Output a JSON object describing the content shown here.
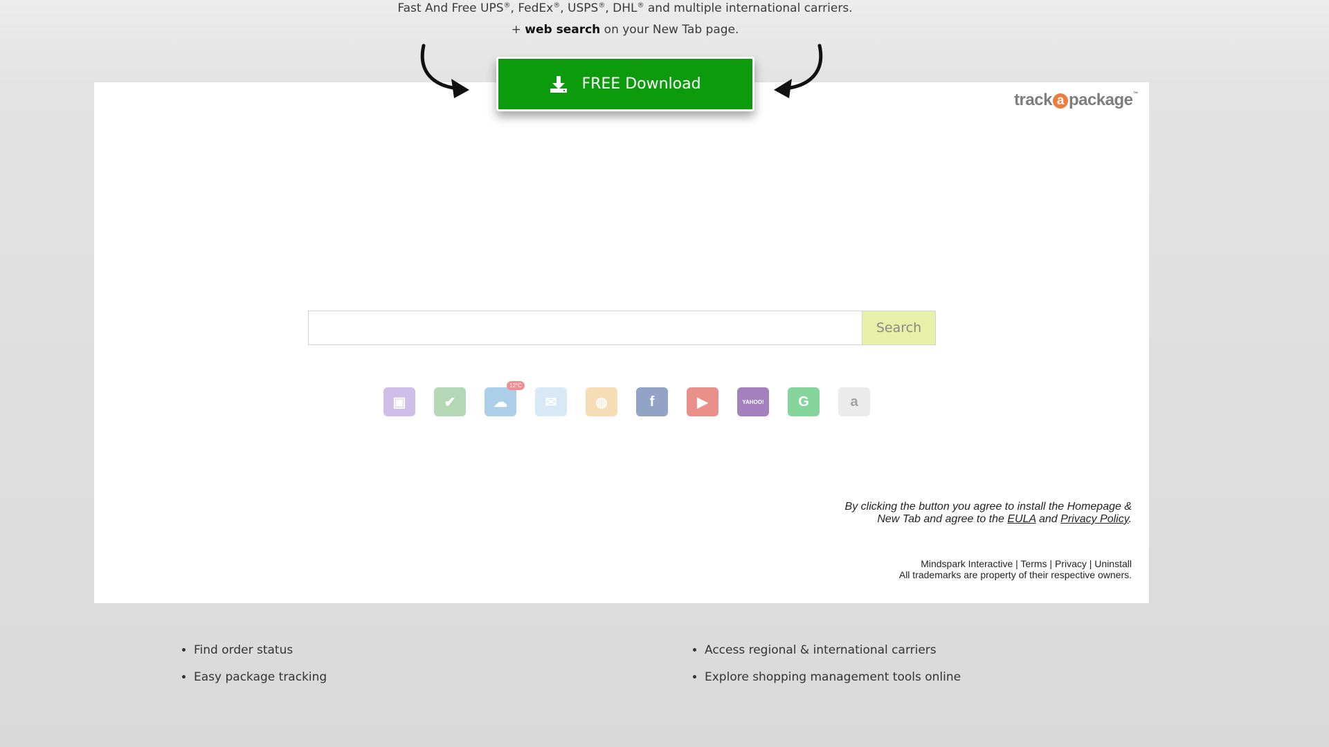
{
  "header": {
    "line1_a": "Fast And Free UPS",
    "line1_b": ", FedEx",
    "line1_c": ", USPS",
    "line1_d": ", DHL",
    "line1_e": " and multiple international carriers.",
    "reg": "®",
    "line2_prefix": "+ ",
    "line2_bold": "web search",
    "line2_suffix": " on your New Tab page."
  },
  "download_button": {
    "label": "FREE Download"
  },
  "logo": {
    "part1": "track",
    "at": "a",
    "part2": "package",
    "tm": "™"
  },
  "search": {
    "placeholder": "",
    "button": "Search"
  },
  "tiles": [
    {
      "name": "package-icon",
      "color": "#a88bd6",
      "glyph": "▣"
    },
    {
      "name": "checklist-icon",
      "color": "#78b97a",
      "glyph": "✔"
    },
    {
      "name": "weather-icon",
      "color": "#6aa8d8",
      "glyph": "☁",
      "badge": "12°C"
    },
    {
      "name": "mail-icon",
      "color": "#b9d8ef",
      "glyph": "✉"
    },
    {
      "name": "globe-icon",
      "color": "#f0c27a",
      "glyph": "◍"
    },
    {
      "name": "facebook-icon",
      "color": "#3b5998",
      "glyph": "f"
    },
    {
      "name": "youtube-icon",
      "color": "#d9362e",
      "glyph": "▶"
    },
    {
      "name": "yahoo-icon",
      "color": "#5a1c8a",
      "glyph": "YAHOO!"
    },
    {
      "name": "grammarly-icon",
      "color": "#22b24c",
      "glyph": "G"
    },
    {
      "name": "amazon-icon",
      "color": "#dcdcdc",
      "glyph": "a"
    }
  ],
  "legal": {
    "text1": "By clicking the button you agree to install the Homepage & New Tab and agree to the ",
    "eula": "EULA",
    "text2": " and ",
    "privacy": "Privacy Policy",
    "text3": "."
  },
  "footer": {
    "company": "Mindspark Interactive",
    "sep": " | ",
    "terms": "Terms",
    "privacy": "Privacy",
    "uninstall": "Uninstall",
    "trademark": "All trademarks are property of their respective owners."
  },
  "features_left": [
    "Find order status",
    "Easy package tracking"
  ],
  "features_right": [
    "Access regional & international carriers",
    "Explore shopping management tools online"
  ]
}
